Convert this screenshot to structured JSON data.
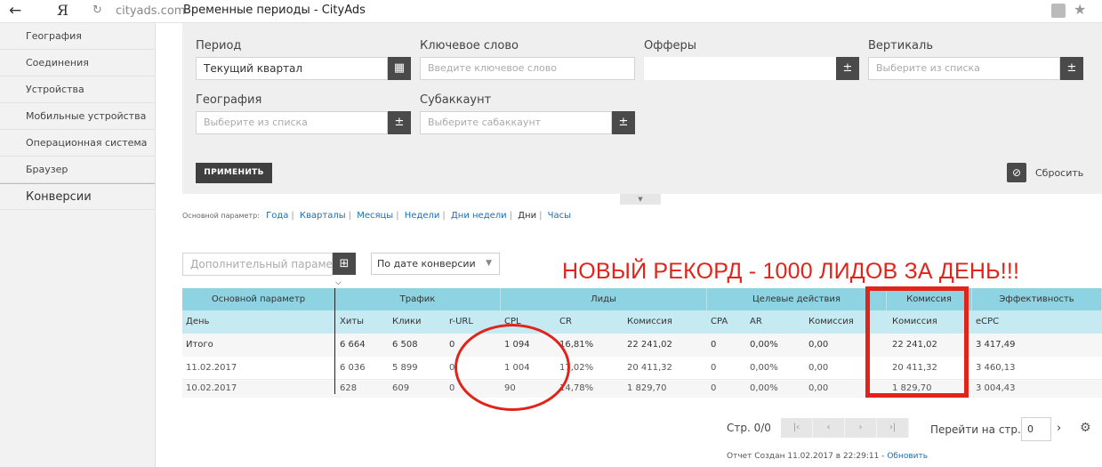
{
  "browser": {
    "back_icon": "back-arrow-icon",
    "yandex_logo": "Я",
    "domain": "cityads.com",
    "title": "Временные периоды - CityAds"
  },
  "sidebar": {
    "items": [
      {
        "label": "География"
      },
      {
        "label": "Соединения"
      },
      {
        "label": "Устройства"
      },
      {
        "label": "Мобильные устройства"
      },
      {
        "label": "Операционная система"
      },
      {
        "label": "Браузер"
      }
    ],
    "section": "Конверсии"
  },
  "filters": {
    "period": {
      "label": "Период",
      "value": "Текущий квартал"
    },
    "keyword": {
      "label": "Ключевое слово",
      "placeholder": "Введите ключевое слово"
    },
    "offers": {
      "label": "Офферы",
      "value": ""
    },
    "vertical": {
      "label": "Вертикаль",
      "placeholder": "Выберите из списка"
    },
    "geo": {
      "label": "География",
      "placeholder": "Выберите из списка"
    },
    "subaccount": {
      "label": "Субаккаунт",
      "placeholder": "Выберите сабаккаунт"
    },
    "btn_symbol": "±",
    "apply": "ПРИМЕНИТЬ",
    "reset": "Сбросить"
  },
  "params": {
    "label": "Основной параметр:",
    "links": [
      "Года",
      "Кварталы",
      "Месяцы",
      "Недели",
      "Дни недели"
    ],
    "current": "Дни",
    "last": "Часы"
  },
  "extra": {
    "add_param_placeholder": "Дополнительный параметр",
    "date_select": "По дате конверсии",
    "record_text": "НОВЫЙ РЕКОРД - 1000 ЛИДОВ ЗА ДЕНЬ!!!"
  },
  "table": {
    "groups": [
      "Основной параметр",
      "Трафик",
      "Лиды",
      "Целевые действия",
      "Комиссия",
      "Эффективность"
    ],
    "columns": [
      "День",
      "Хиты",
      "Клики",
      "r-URL",
      "CPL",
      "CR",
      "Комиссия",
      "CPA",
      "AR",
      "Комиссия",
      "Комиссия",
      "eCPC"
    ],
    "rows": [
      [
        "Итого",
        "6 664",
        "6 508",
        "0",
        "1 094",
        "16,81%",
        "22 241,02",
        "0",
        "0,00%",
        "0,00",
        "22 241,02",
        "3 417,49"
      ],
      [
        "11.02.2017",
        "6 036",
        "5 899",
        "0",
        "1 004",
        "17,02%",
        "20 411,32",
        "0",
        "0,00%",
        "0,00",
        "20 411,32",
        "3 460,13"
      ],
      [
        "10.02.2017",
        "628",
        "609",
        "0",
        "90",
        "14,78%",
        "1 829,70",
        "0",
        "0,00%",
        "0,00",
        "1 829,70",
        "3 004,43"
      ]
    ]
  },
  "pager": {
    "label": "Стр. 0/0",
    "buttons": [
      "first-page",
      "prev-page",
      "next-page",
      "last-page"
    ],
    "goto_label": "Перейти на стр.",
    "goto_value": "0"
  },
  "footer": {
    "text": "Отчет Создан 11.02.2017 в 22:29:11 -",
    "link": "Обновить"
  }
}
